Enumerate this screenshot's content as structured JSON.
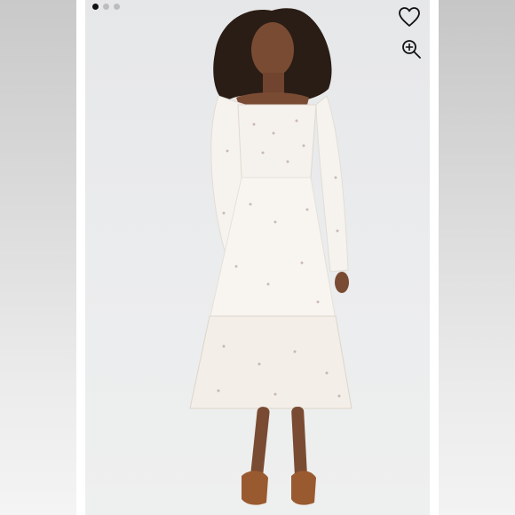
{
  "viewer": {
    "carousel": {
      "total": 3,
      "active_index": 0
    },
    "actions": {
      "like_icon": "heart-outline-icon",
      "zoom_icon": "zoom-in-icon"
    }
  },
  "colors": {
    "dot_active": "#111111",
    "dot_inactive": "#bdbdbd",
    "photo_background": "#e8e9ea"
  }
}
